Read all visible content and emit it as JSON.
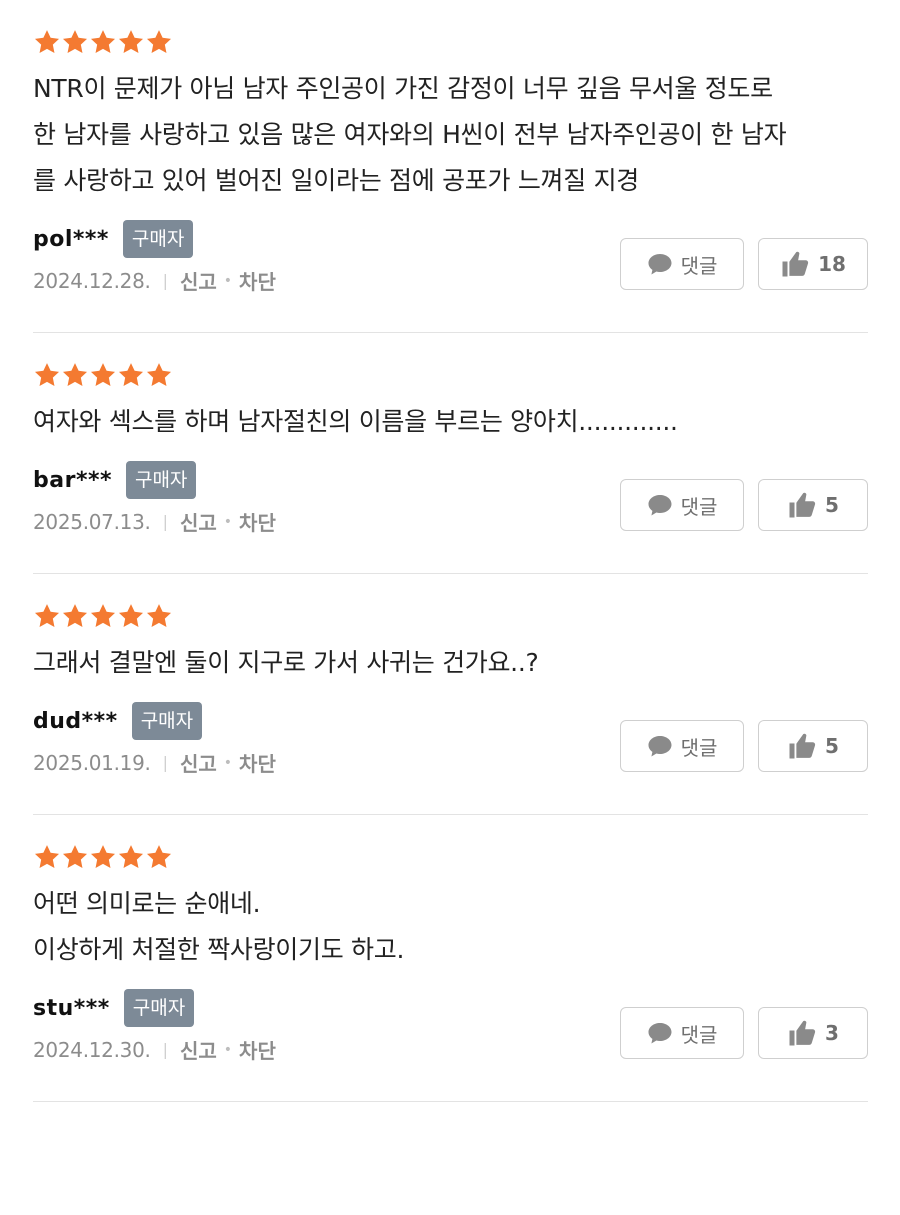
{
  "colors": {
    "star": "#f47a31",
    "badge": "#7d8a97",
    "divider": "#e3e3e3"
  },
  "reviews": [
    {
      "rating": 5,
      "text_lines": [
        "NTR이 문제가 아님 남자 주인공이 가진 감정이 너무 깊음 무서울 정도로",
        "한 남자를 사랑하고 있음 많은 여자와의 H씬이 전부 남자주인공이 한 남자",
        "를 사랑하고 있어 벌어진 일이라는 점에 공포가 느껴질 지경"
      ],
      "user": "pol***",
      "badge": "구매자",
      "date": "2024.12.28.",
      "report": "신고",
      "block": "차단",
      "comment_label": "댓글",
      "likes": "18"
    },
    {
      "rating": 5,
      "text_lines": [
        "여자와 섹스를 하며 남자절친의 이름을 부르는 양아치............."
      ],
      "user": "bar***",
      "badge": "구매자",
      "date": "2025.07.13.",
      "report": "신고",
      "block": "차단",
      "comment_label": "댓글",
      "likes": "5"
    },
    {
      "rating": 5,
      "text_lines": [
        "그래서 결말엔 둘이 지구로 가서 사귀는 건가요..?"
      ],
      "user": "dud***",
      "badge": "구매자",
      "date": "2025.01.19.",
      "report": "신고",
      "block": "차단",
      "comment_label": "댓글",
      "likes": "5"
    },
    {
      "rating": 5,
      "text_lines": [
        "어떤 의미로는 순애네.",
        "이상하게 처절한 짝사랑이기도 하고."
      ],
      "user": "stu***",
      "badge": "구매자",
      "date": "2024.12.30.",
      "report": "신고",
      "block": "차단",
      "comment_label": "댓글",
      "likes": "3"
    }
  ]
}
